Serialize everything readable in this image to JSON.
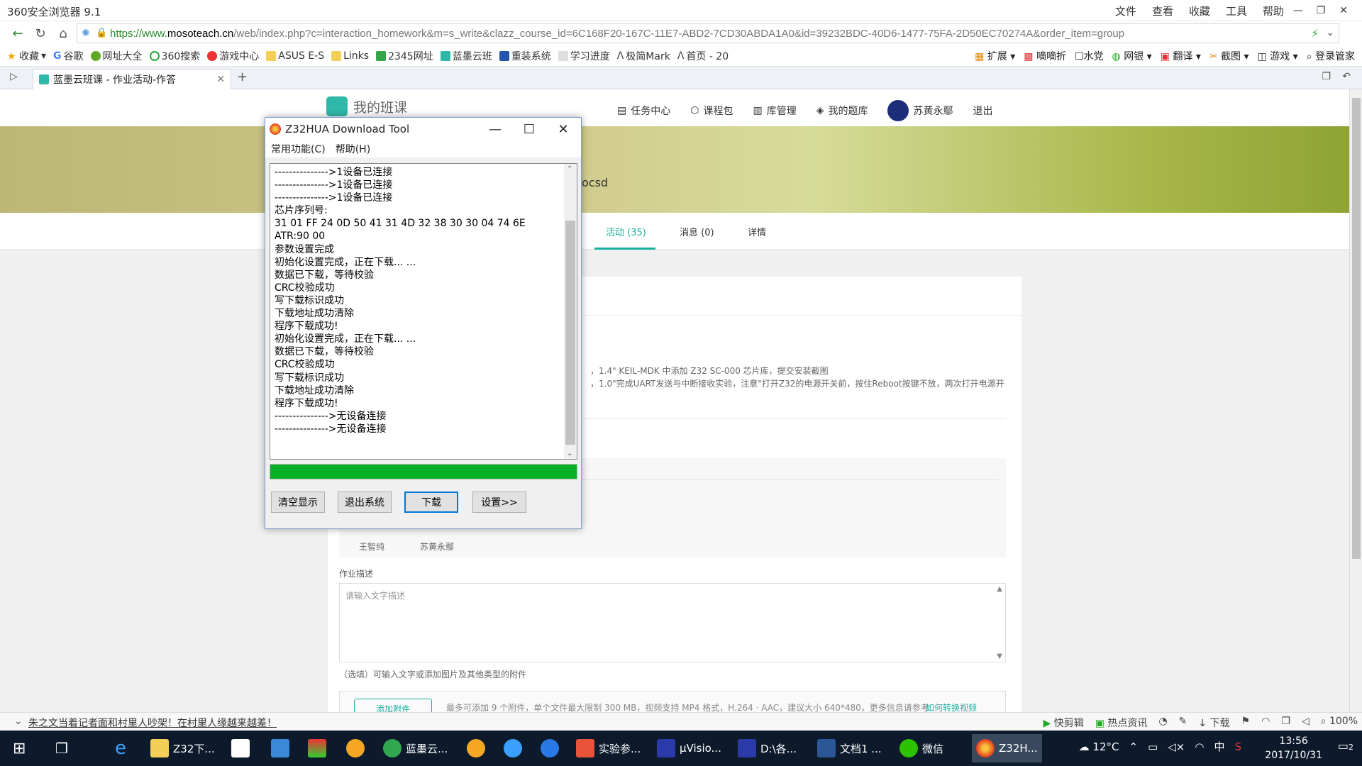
{
  "browser": {
    "title": "360安全浏览器 9.1",
    "menu": [
      "文件",
      "查看",
      "收藏",
      "工具",
      "帮助"
    ],
    "url_scheme": "https://www.",
    "url_host": "mosoteach.cn",
    "url_path": "/web/index.php?c=interaction_homework&m=s_write&clazz_course_id=6C168F20-167C-11E7-ABD2-7CD30ABDA1A0&id=39232BDC-40D6-1477-75FA-2D50EC70274A&order_item=group",
    "bookmarks": [
      "收藏",
      "谷歌",
      "网址大全",
      "360搜索",
      "游戏中心",
      "ASUS E-S",
      "Links",
      "2345网址",
      "蓝墨云班",
      "重装系统",
      "学习进度",
      "极简Mark",
      "首页 - 20"
    ],
    "bookmarks_right": [
      "扩展",
      "嘀嘀折",
      "水党",
      "网银",
      "翻译",
      "截图",
      "游戏",
      "登录管家"
    ],
    "tab_label": "蓝墨云班课 - 作业活动-作答"
  },
  "page": {
    "logo_text": "我的班课",
    "nav": [
      "任务中心",
      "课程包",
      "库管理",
      "我的题库",
      "苏黄永鄢",
      "退出"
    ],
    "banner_text": "ocsd",
    "tabs": [
      "活动 (35)",
      "消息 (0)",
      "详情"
    ],
    "content_lines": [
      "，1.4\" KEIL-MDK 中添加 Z32 SC-000 芯片库，提交安装截图",
      "，1.0\"完成UART发送与中断接收实验，注意\"打开Z32的电源开关前，按住Reboot按键不放，两次打开电源开"
    ],
    "members": [
      "王智纯",
      "苏黄永鄢"
    ],
    "desc_label": "作业描述",
    "desc_placeholder": "请输入文字描述",
    "hint": "（选填）可输入文字或添加图片及其他类型的附件",
    "attach_text": "最多可添加 9 个附件，单个文件最大限制 300 MB，视频支持 MP4 格式，H.264 · AAC，建议大小 640*480，更多信息请参考",
    "attach_link": "如何转换视频",
    "attach_button": "添加附件"
  },
  "status": {
    "news": "朱之文当着记者面和村里人吵架！在村里人缘越来越差！",
    "right": [
      "快剪辑",
      "热点资讯",
      "下载",
      "100%"
    ]
  },
  "taskbar": {
    "items": [
      "Z32下...",
      "蓝墨云...",
      "实验参...",
      "μVisio...",
      "D:\\各...",
      "文档1 ...",
      "微信",
      "Z32H..."
    ],
    "weather": "12°C",
    "ime": "中",
    "time": "13:56",
    "date": "2017/10/31",
    "notify": "2"
  },
  "dialog": {
    "title": "Z32HUA Download Tool",
    "menu": [
      "常用功能(C)",
      "帮助(H)"
    ],
    "log": [
      "--------------->1设备已连接",
      "--------------->1设备已连接",
      "--------------->1设备已连接",
      "芯片序列号:",
      "31 01 FF 24 0D 50 41 31 4D 32 38 30 30 04 74 6E",
      "ATR:90 00",
      "参数设置完成",
      "初始化设置完成，正在下载... ...",
      "数据已下载，等待校验",
      "CRC校验成功",
      "写下载标识成功",
      "下载地址成功清除",
      "程序下载成功!",
      "初始化设置完成，正在下载... ...",
      "数据已下载，等待校验",
      "CRC校验成功",
      "写下载标识成功",
      "下载地址成功清除",
      "程序下载成功!",
      "--------------->无设备连接",
      "--------------->无设备连接"
    ],
    "progress": 1.0,
    "buttons": [
      "清空显示",
      "退出系统",
      "下载",
      "设置>>"
    ],
    "progress_color": "#06b025"
  }
}
